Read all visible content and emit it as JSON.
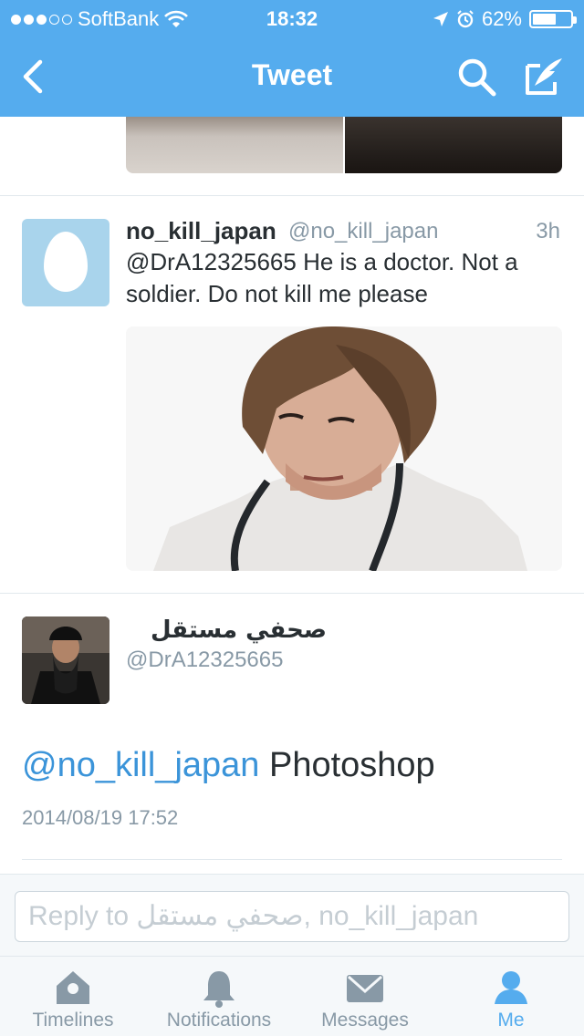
{
  "status_bar": {
    "carrier": "SoftBank",
    "time": "18:32",
    "battery": "62%",
    "battery_level": 0.62,
    "signal_dots": [
      true,
      true,
      true,
      false,
      false
    ]
  },
  "nav": {
    "title": "Tweet",
    "back_icon": "chevron-left-icon",
    "search_icon": "search-icon",
    "compose_icon": "compose-icon"
  },
  "tweet": {
    "name": "no_kill_japan",
    "handle": "@no_kill_japan",
    "time": "3h",
    "text": "@DrA12325665 He is a doctor. Not a soldier. Do not kill me please"
  },
  "main_tweet": {
    "name": "صحفي مستقل",
    "handle": "@DrA12325665",
    "mention": "@no_kill_japan",
    "text": " Photoshop",
    "date": "2014/08/19 17:52"
  },
  "reply": {
    "placeholder": "Reply to صحفي مستقل, no_kill_japan"
  },
  "tabs": [
    {
      "label": "Timelines",
      "icon": "home-icon"
    },
    {
      "label": "Notifications",
      "icon": "bell-icon"
    },
    {
      "label": "Messages",
      "icon": "envelope-icon"
    },
    {
      "label": "Me",
      "icon": "person-icon",
      "active": true
    }
  ],
  "colors": {
    "brand": "#55acee",
    "link": "#3b94d9",
    "muted": "#8899a6",
    "text": "#292f33"
  }
}
